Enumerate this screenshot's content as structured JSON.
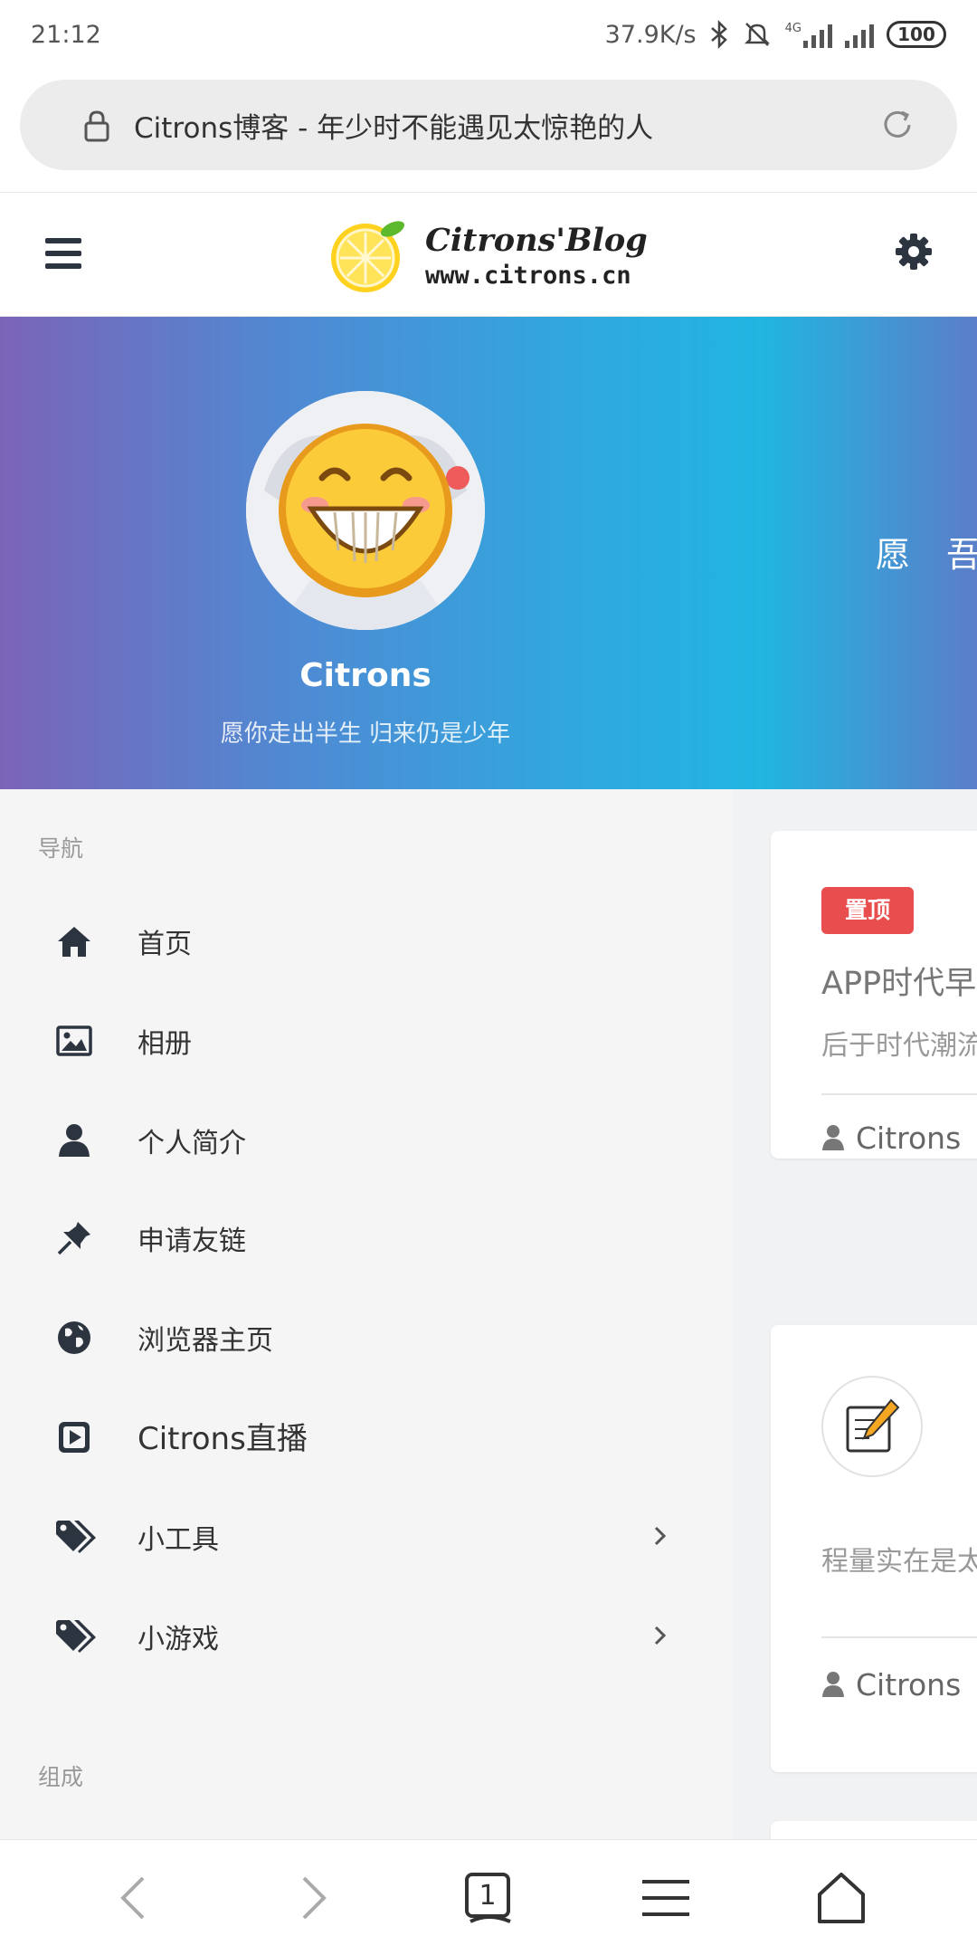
{
  "status_bar": {
    "time": "21:12",
    "speed": "37.9K/s",
    "network_type": "4G",
    "battery": "100"
  },
  "url_bar": {
    "title": "Citrons博客 - 年少时不能遇见太惊艳的人"
  },
  "header": {
    "logo_name": "Citrons'Blog",
    "logo_url": "www.citrons.cn"
  },
  "hero": {
    "name": "Citrons",
    "motto": "愿你走出半生 归来仍是少年",
    "slogan": "愿 吾 −"
  },
  "sidebar": {
    "nav_section": "导航",
    "items": [
      {
        "label": "首页",
        "icon": "home-icon"
      },
      {
        "label": "相册",
        "icon": "image-icon"
      },
      {
        "label": "个人简介",
        "icon": "user-icon"
      },
      {
        "label": "申请友链",
        "icon": "pin-icon"
      },
      {
        "label": "浏览器主页",
        "icon": "globe-icon"
      },
      {
        "label": "Citrons直播",
        "icon": "play-icon"
      },
      {
        "label": "小工具",
        "icon": "tags-icon"
      },
      {
        "label": "小游戏",
        "icon": "tags-icon"
      }
    ],
    "compose_section": "组成"
  },
  "content": {
    "card1": {
      "badge": "置顶",
      "line1": "APP时代早",
      "line2": "后于时代潮流",
      "author": "Citrons"
    },
    "card2": {
      "line1": "程量实在是太",
      "author": "Citrons",
      "icon": "edit-icon"
    }
  },
  "bottom_bar": {
    "tab_count": "1"
  },
  "colors": {
    "badge_red": "#e94e4e",
    "icon_dark": "#2c3440"
  }
}
